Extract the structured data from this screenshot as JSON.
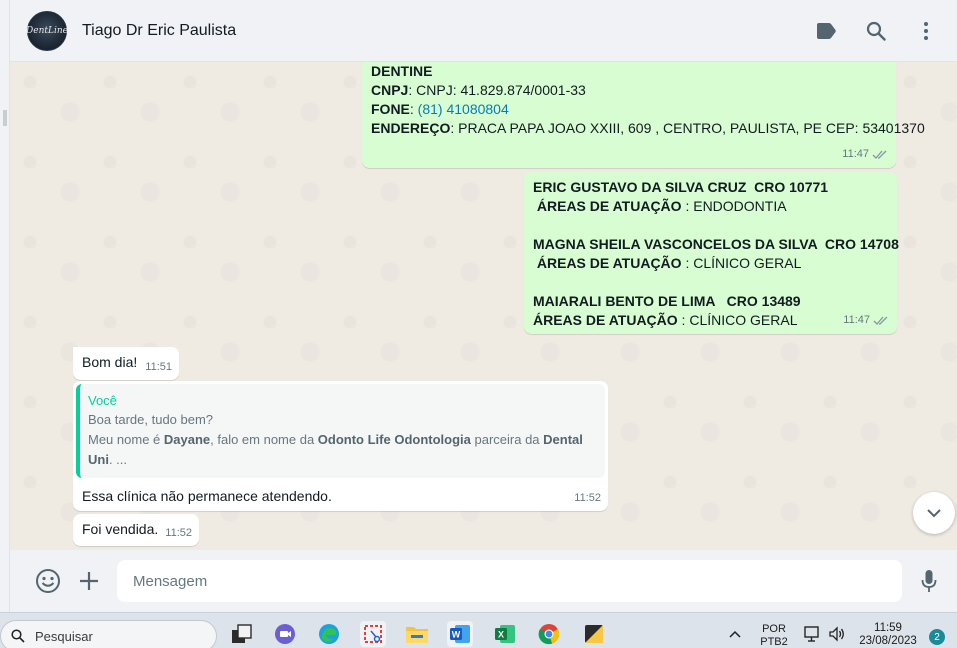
{
  "header": {
    "avatar_text": "DentLine",
    "contact_name": "Tiago Dr Eric Paulista",
    "icons": [
      "label-icon",
      "search-icon",
      "menu-icon"
    ]
  },
  "messages": {
    "m1": {
      "name": "DENTINE",
      "cnpj_label": "CNPJ",
      "cnpj_value": ": CNPJ: 41.829.874/0001-33",
      "fone_label": "FONE",
      "fone_sep": ": ",
      "fone_value": "(81) 41080804",
      "end_label": "ENDEREÇO",
      "end_value": ": PRACA PAPA JOAO XXIII, 609 , CENTRO, PAULISTA, PE CEP: 53401370",
      "time": "11:47"
    },
    "m2": {
      "d1_name": "ERIC GUSTAVO DA SILVA CRUZ  CRO 10771",
      "d1_area_label": " ÁREAS DE ATUAÇÃO",
      "d1_area_value": " : ENDODONTIA",
      "d2_name": "MAGNA SHEILA VASCONCELOS DA SILVA  CRO 14708",
      "d2_area_label": " ÁREAS DE ATUAÇÃO",
      "d2_area_value": " : CLÍNICO GERAL",
      "d3_name": "MAIARALI BENTO DE LIMA   CRO 13489",
      "d3_area_label": "ÁREAS DE ATUAÇÃO",
      "d3_area_value": " : CLÍNICO GERAL",
      "time": "11:47"
    },
    "m3": {
      "text": "Bom dia!",
      "time": "11:51"
    },
    "m4": {
      "quote_author": "Você",
      "quote_line1": "Boa tarde, tudo bem?",
      "quote_l2a": "Meu nome é ",
      "quote_l2b": "Dayane",
      "quote_l2c": ", falo em nome da ",
      "quote_l2d": "Odonto Life Odontologia",
      "quote_l2e": " parceira da ",
      "quote_l2f": "Dental",
      "quote_l3a": "Uni",
      "quote_l3b": ". ...",
      "text": "Essa clínica não permanece atendendo.",
      "time": "11:52"
    },
    "m5": {
      "text": "Foi vendida.",
      "time": "11:52"
    }
  },
  "composer": {
    "placeholder": "Mensagem"
  },
  "taskbar": {
    "search_label": "Pesquisar",
    "lang_line1": "POR",
    "lang_line2": "PTB2",
    "time": "11:59",
    "date": "23/08/2023",
    "notifications": "2"
  }
}
